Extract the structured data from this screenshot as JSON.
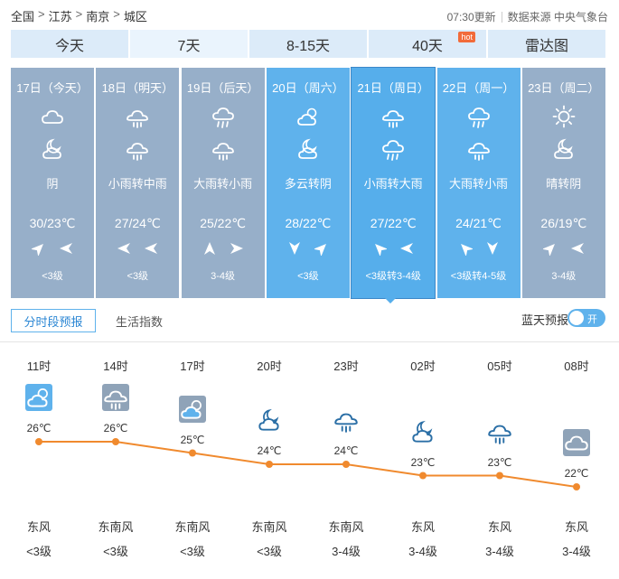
{
  "breadcrumb": [
    "全国",
    "江苏",
    "南京",
    "城区"
  ],
  "breadcrumb_sep": ">",
  "update_time": "07:30更新",
  "data_source": "数据来源 中央气象台",
  "tabs": [
    {
      "label": "今天"
    },
    {
      "label": "7天",
      "active": true
    },
    {
      "label": "8-15天"
    },
    {
      "label": "40天",
      "badge": "hot"
    },
    {
      "label": "雷达图"
    }
  ],
  "days": [
    {
      "date": "17日（今天）",
      "icon_day": "cloud-icon",
      "icon_night": "cloudy-night-icon",
      "desc": "阴",
      "temp": "30/23℃",
      "wind": [
        "northeast-arrow-icon",
        "west-arrow-icon"
      ],
      "level": "<3级",
      "state": "past"
    },
    {
      "date": "18日（明天）",
      "icon_day": "rain-icon",
      "icon_night": "rain-icon",
      "desc": "小雨转中雨",
      "temp": "27/24℃",
      "wind": [
        "west-arrow-icon",
        "west-arrow-icon"
      ],
      "level": "<3级",
      "state": "past"
    },
    {
      "date": "19日（后天）",
      "icon_day": "heavy-rain-icon",
      "icon_night": "rain-icon",
      "desc": "大雨转小雨",
      "temp": "25/22℃",
      "wind": [
        "north-arrow-icon",
        "east-arrow-icon"
      ],
      "level": "3-4级",
      "state": "past"
    },
    {
      "date": "20日（周六）",
      "icon_day": "partly-cloudy-day-icon",
      "icon_night": "cloudy-night-icon",
      "desc": "多云转阴",
      "temp": "28/22℃",
      "wind": [
        "south-arrow-icon",
        "northeast-arrow-icon"
      ],
      "level": "<3级",
      "state": "future"
    },
    {
      "date": "21日（周日）",
      "icon_day": "rain-icon",
      "icon_night": "heavy-rain-icon",
      "desc": "小雨转大雨",
      "temp": "27/22℃",
      "wind": [
        "northwest-arrow-icon",
        "west-arrow-icon"
      ],
      "level": "<3级转3-4级",
      "state": "sel"
    },
    {
      "date": "22日（周一）",
      "icon_day": "heavy-rain-icon",
      "icon_night": "rain-icon",
      "desc": "大雨转小雨",
      "temp": "24/21℃",
      "wind": [
        "northwest-arrow-icon",
        "south-arrow-icon"
      ],
      "level": "<3级转4-5级",
      "state": "future"
    },
    {
      "date": "23日（周二）",
      "icon_day": "sun-icon",
      "icon_night": "cloudy-night-icon",
      "desc": "晴转阴",
      "temp": "26/19℃",
      "wind": [
        "northeast-arrow-icon",
        "west-arrow-icon"
      ],
      "level": "3-4级",
      "state": "past"
    }
  ],
  "subtabs": {
    "hourly": "分时段预报",
    "life": "生活指数"
  },
  "blue_sky": {
    "label": "蓝天预报",
    "toggle": "开"
  },
  "hourly": [
    {
      "time": "11时",
      "icon": "partly-cloudy-day-icon",
      "temp": 26,
      "temp_label": "26℃",
      "wind_dir": "东风",
      "wind_level": "<3级"
    },
    {
      "time": "14时",
      "icon": "rain-icon",
      "temp": 26,
      "temp_label": "26℃",
      "wind_dir": "东南风",
      "wind_level": "<3级"
    },
    {
      "time": "17时",
      "icon": "partly-cloudy-day-icon",
      "temp": 25,
      "temp_label": "25℃",
      "wind_dir": "东南风",
      "wind_level": "<3级"
    },
    {
      "time": "20时",
      "icon": "cloudy-night-icon",
      "temp": 24,
      "temp_label": "24℃",
      "wind_dir": "东南风",
      "wind_level": "<3级"
    },
    {
      "time": "23时",
      "icon": "rain-icon",
      "temp": 24,
      "temp_label": "24℃",
      "wind_dir": "东南风",
      "wind_level": "3-4级"
    },
    {
      "time": "02时",
      "icon": "cloudy-night-icon",
      "temp": 23,
      "temp_label": "23℃",
      "wind_dir": "东风",
      "wind_level": "3-4级"
    },
    {
      "time": "05时",
      "icon": "rain-icon",
      "temp": 23,
      "temp_label": "23℃",
      "wind_dir": "东风",
      "wind_level": "3-4级"
    },
    {
      "time": "08时",
      "icon": "cloud-icon",
      "temp": 22,
      "temp_label": "22℃",
      "wind_dir": "东风",
      "wind_level": "3-4级"
    }
  ],
  "colors": {
    "accent": "#5fb2ec",
    "past": "#97afc9",
    "curve": "#f08a2e"
  }
}
